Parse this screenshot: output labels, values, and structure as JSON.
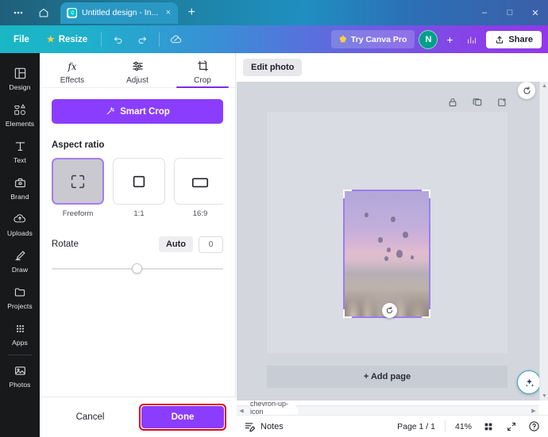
{
  "browser": {
    "menu_icon": "ellipsis-icon",
    "home_icon": "home-icon",
    "tab": {
      "favicon": "canva-icon",
      "title": "Untitled design - In...",
      "close": "×"
    },
    "new_tab": "+",
    "window_controls": {
      "minimize": "–",
      "maximize": "□",
      "close": "✕"
    }
  },
  "header": {
    "file_label": "File",
    "resize_label": "Resize",
    "crown_icon": "crown-icon",
    "undo_icon": "undo-icon",
    "redo_icon": "redo-icon",
    "cloud_icon": "cloud-saved-icon",
    "try_pro_label": "Try Canva Pro",
    "avatar_initial": "N",
    "add_collaborator": "+",
    "insights_icon": "insights-icon",
    "share_label": "Share",
    "accent_purple": "#8b3dff",
    "accent_teal": "#1ab7c4"
  },
  "rail": {
    "items": [
      {
        "label": "Design",
        "icon": "design-icon"
      },
      {
        "label": "Elements",
        "icon": "elements-icon"
      },
      {
        "label": "Text",
        "icon": "text-icon"
      },
      {
        "label": "Brand",
        "icon": "brand-icon"
      },
      {
        "label": "Uploads",
        "icon": "uploads-icon"
      },
      {
        "label": "Draw",
        "icon": "draw-icon"
      },
      {
        "label": "Projects",
        "icon": "projects-icon"
      },
      {
        "label": "Apps",
        "icon": "apps-icon"
      },
      {
        "label": "Photos",
        "icon": "photos-icon"
      }
    ]
  },
  "panel": {
    "tabs": [
      {
        "label": "Effects",
        "icon": "effects-fx-icon",
        "active": false
      },
      {
        "label": "Adjust",
        "icon": "adjust-sliders-icon",
        "active": false
      },
      {
        "label": "Crop",
        "icon": "crop-icon",
        "active": true
      }
    ],
    "smart_crop_label": "Smart Crop",
    "smart_crop_icon": "magic-wand-icon",
    "aspect_ratio_title": "Aspect ratio",
    "ratios": [
      {
        "label": "Freeform",
        "icon": "freeform-icon",
        "selected": true
      },
      {
        "label": "1:1",
        "icon": "square-icon",
        "selected": false
      },
      {
        "label": "16:9",
        "icon": "wide-rect-icon",
        "selected": false
      },
      {
        "label": "",
        "icon": "portrait-rect-icon",
        "selected": false
      }
    ],
    "rotate_label": "Rotate",
    "rotate_auto_label": "Auto",
    "rotate_value": "0",
    "cancel_label": "Cancel",
    "done_label": "Done",
    "done_highlight_color": "#e2001a"
  },
  "canvas": {
    "edit_photo_label": "Edit photo",
    "page_tools": [
      {
        "icon": "lock-icon"
      },
      {
        "icon": "duplicate-page-icon"
      },
      {
        "icon": "add-page-icon"
      }
    ],
    "rotate_handle_icon": "rotate-icon",
    "side_rotate_icon": "rotate-clockwise-icon",
    "add_page_label": "+ Add page",
    "magic_icon": "magic-sparkle-icon",
    "photo_alt": "hot-air-balloons-over-cappadocia",
    "crop_border_color": "#9b7ef0"
  },
  "statusbar": {
    "notes_label": "Notes",
    "notes_icon": "notes-icon",
    "page_indicator": "Page 1 / 1",
    "zoom_level": "41%",
    "grid_icon": "grid-view-icon",
    "fullscreen_icon": "fullscreen-icon",
    "help_icon": "help-icon",
    "collapse_icon": "chevron-up-icon"
  }
}
